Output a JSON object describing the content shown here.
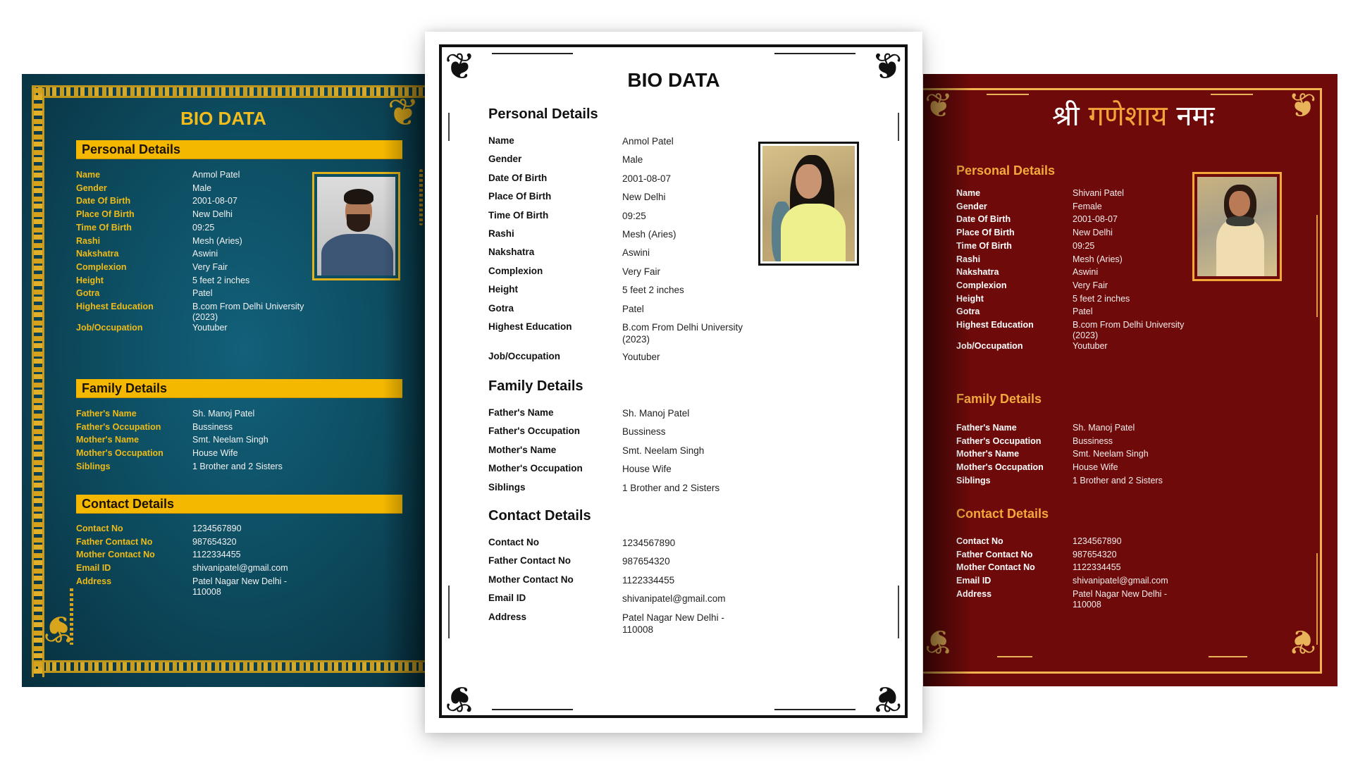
{
  "templates": [
    {
      "id": "teal",
      "theme": {
        "background": "#0d4d61",
        "accent": "#f5b800",
        "label_color": "#f0bb16",
        "value_color": "#f2f2f2"
      },
      "title": "BIO DATA",
      "photo": "male-portrait",
      "sections": {
        "personal": {
          "heading": "Personal Details",
          "rows": [
            {
              "label": "Name",
              "value": "Anmol Patel"
            },
            {
              "label": "Gender",
              "value": "Male"
            },
            {
              "label": "Date Of Birth",
              "value": "2001-08-07"
            },
            {
              "label": "Place Of Birth",
              "value": "New Delhi"
            },
            {
              "label": "Time Of Birth",
              "value": "09:25"
            },
            {
              "label": "Rashi",
              "value": "Mesh (Aries)"
            },
            {
              "label": "Nakshatra",
              "value": "Aswini"
            },
            {
              "label": "Complexion",
              "value": "Very Fair"
            },
            {
              "label": "Height",
              "value": "5 feet 2 inches"
            },
            {
              "label": "Gotra",
              "value": "Patel"
            },
            {
              "label": "Highest Education",
              "value": "B.com From Delhi University",
              "value2": "(2023)"
            },
            {
              "label": "Job/Occupation",
              "value": "Youtuber"
            }
          ]
        },
        "family": {
          "heading": "Family Details",
          "rows": [
            {
              "label": "Father's Name",
              "value": "Sh. Manoj Patel"
            },
            {
              "label": "Father's Occupation",
              "value": "Bussiness"
            },
            {
              "label": "Mother's Name",
              "value": "Smt. Neelam Singh"
            },
            {
              "label": "Mother's Occupation",
              "value": "House Wife"
            },
            {
              "label": "Siblings",
              "value": "1 Brother and 2 Sisters"
            }
          ]
        },
        "contact": {
          "heading": "Contact Details",
          "rows": [
            {
              "label": "Contact No",
              "value": "1234567890"
            },
            {
              "label": "Father Contact No",
              "value": "987654320"
            },
            {
              "label": "Mother Contact No",
              "value": "1122334455"
            },
            {
              "label": "Email ID",
              "value": "shivanipatel@gmail.com"
            },
            {
              "label": "Address",
              "value": "Patel Nagar New Delhi -",
              "value2": "110008"
            }
          ]
        }
      }
    },
    {
      "id": "white",
      "theme": {
        "background": "#ffffff",
        "accent": "#111111",
        "label_color": "#111111",
        "value_color": "#222222"
      },
      "title": "BIO DATA",
      "photo": "female-portrait",
      "sections": {
        "personal": {
          "heading": "Personal Details",
          "rows": [
            {
              "label": "Name",
              "value": "Anmol Patel"
            },
            {
              "label": "Gender",
              "value": "Male"
            },
            {
              "label": "Date Of Birth",
              "value": "2001-08-07"
            },
            {
              "label": "Place Of Birth",
              "value": "New Delhi"
            },
            {
              "label": "Time Of Birth",
              "value": "09:25"
            },
            {
              "label": "Rashi",
              "value": "Mesh (Aries)"
            },
            {
              "label": "Nakshatra",
              "value": "Aswini"
            },
            {
              "label": "Complexion",
              "value": "Very Fair"
            },
            {
              "label": "Height",
              "value": "5 feet 2 inches"
            },
            {
              "label": "Gotra",
              "value": "Patel"
            },
            {
              "label": "Highest Education",
              "value": "B.com From Delhi University",
              "value2": "(2023)"
            },
            {
              "label": "Job/Occupation",
              "value": "Youtuber"
            }
          ]
        },
        "family": {
          "heading": "Family Details",
          "rows": [
            {
              "label": "Father's Name",
              "value": "Sh. Manoj Patel"
            },
            {
              "label": "Father's Occupation",
              "value": "Bussiness"
            },
            {
              "label": "Mother's Name",
              "value": "Smt. Neelam Singh"
            },
            {
              "label": "Mother's Occupation",
              "value": "House Wife"
            },
            {
              "label": "Siblings",
              "value": "1 Brother and 2 Sisters"
            }
          ]
        },
        "contact": {
          "heading": "Contact Details",
          "rows": [
            {
              "label": "Contact No",
              "value": "1234567890"
            },
            {
              "label": "Father Contact No",
              "value": "987654320"
            },
            {
              "label": "Mother Contact No",
              "value": "1122334455"
            },
            {
              "label": "Email ID",
              "value": "shivanipatel@gmail.com"
            },
            {
              "label": "Address",
              "value": "Patel Nagar New Delhi -",
              "value2": "110008"
            }
          ]
        }
      }
    },
    {
      "id": "red",
      "theme": {
        "background": "#6e0a0a",
        "accent": "#f5a93c",
        "label_color": "#ffffff",
        "value_color": "#f4ecec"
      },
      "title_devanagari": {
        "part1": "श्री",
        "part2": "गणेशाय",
        "part3": "नमः"
      },
      "photo": "female-portrait",
      "sections": {
        "personal": {
          "heading": "Personal Details",
          "rows": [
            {
              "label": "Name",
              "value": "Shivani Patel"
            },
            {
              "label": "Gender",
              "value": "Female"
            },
            {
              "label": "Date Of Birth",
              "value": "2001-08-07"
            },
            {
              "label": "Place Of Birth",
              "value": "New Delhi"
            },
            {
              "label": "Time Of Birth",
              "value": "09:25"
            },
            {
              "label": "Rashi",
              "value": "Mesh (Aries)"
            },
            {
              "label": "Nakshatra",
              "value": "Aswini"
            },
            {
              "label": "Complexion",
              "value": "Very Fair"
            },
            {
              "label": "Height",
              "value": "5 feet 2 inches"
            },
            {
              "label": "Gotra",
              "value": "Patel"
            },
            {
              "label": "Highest Education",
              "value": "B.com From Delhi University",
              "value2": "(2023)"
            },
            {
              "label": "Job/Occupation",
              "value": "Youtuber"
            }
          ]
        },
        "family": {
          "heading": "Family Details",
          "rows": [
            {
              "label": "Father's Name",
              "value": "Sh. Manoj Patel"
            },
            {
              "label": "Father's Occupation",
              "value": "Bussiness"
            },
            {
              "label": "Mother's Name",
              "value": "Smt. Neelam Singh"
            },
            {
              "label": "Mother's Occupation",
              "value": "House Wife"
            },
            {
              "label": "Siblings",
              "value": "1 Brother and 2 Sisters"
            }
          ]
        },
        "contact": {
          "heading": "Contact Details",
          "rows": [
            {
              "label": "Contact No",
              "value": "1234567890"
            },
            {
              "label": "Father Contact No",
              "value": "987654320"
            },
            {
              "label": "Mother Contact No",
              "value": "1122334455"
            },
            {
              "label": "Email ID",
              "value": "shivanipatel@gmail.com"
            },
            {
              "label": "Address",
              "value": "Patel Nagar New Delhi -",
              "value2": "110008"
            }
          ]
        }
      }
    }
  ]
}
